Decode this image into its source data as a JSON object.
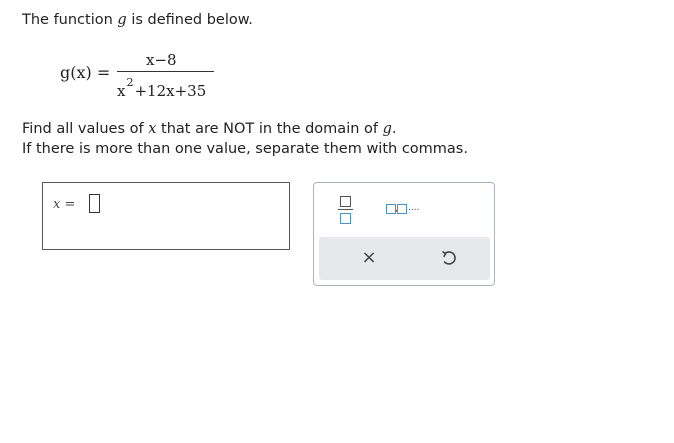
{
  "problem": {
    "intro_before": "The function ",
    "intro_var": "g",
    "intro_after": " is defined below.",
    "formula": {
      "lhs": "g(x) =",
      "numerator": "x−8",
      "den_x": "x",
      "den_exp": "2",
      "den_rest": "+12x+35"
    },
    "instruction_1_before": "Find all values of ",
    "instruction_1_var": "x",
    "instruction_1_mid": " that are NOT in the domain of ",
    "instruction_1_var2": "g",
    "instruction_1_end": ".",
    "instruction_2": "If there is more than one value, separate them with commas."
  },
  "answer": {
    "label": "x =",
    "value": ""
  },
  "palette": {
    "fraction_icon": "fraction-icon",
    "list_icon": "list-icon",
    "list_dots": "....",
    "clear_glyph": "×",
    "clear_icon": "close-icon",
    "reset_icon": "undo-icon",
    "accent_color": "#4a90c9"
  }
}
